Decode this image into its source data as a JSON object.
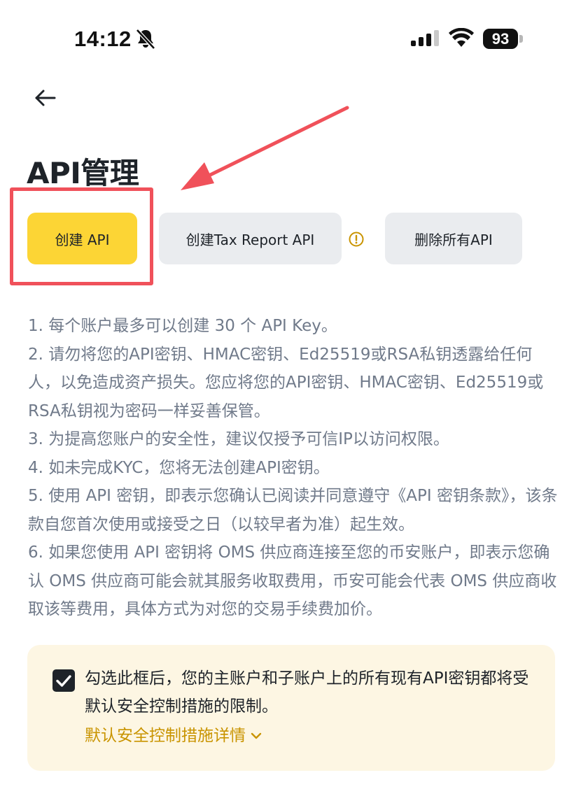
{
  "status_bar": {
    "time": "14:12",
    "battery": "93",
    "icons": [
      "bell-off-icon",
      "signal-icon",
      "wifi-icon",
      "battery-icon"
    ]
  },
  "header": {
    "back_icon": "arrow-left-icon"
  },
  "page_title": "API管理",
  "buttons": {
    "create_api": "创建 API",
    "create_tax_report_api": "创建Tax Report API",
    "delete_all_api": "删除所有API"
  },
  "notes": [
    "1. 每个账户最多可以创建 30 个 API Key。",
    "2. 请勿将您的API密钥、HMAC密钥、Ed25519或RSA私钥透露给任何人，以免造成资产损失。您应将您的API密钥、HMAC密钥、Ed25519或RSA私钥视为密码一样妥善保管。",
    "3. 为提高您账户的安全性，建议仅授予可信IP以访问权限。",
    "4. 如未完成KYC，您将无法创建API密钥。",
    "5. 使用 API 密钥，即表示您确认已阅读并同意遵守《API 密钥条款》，该条款自您首次使用或接受之日（以较早者为准）起生效。",
    "6. 如果您使用 API 密钥将 OMS 供应商连接至您的币安账户，即表示您确认 OMS 供应商可能会就其服务收取费用，币安可能会代表 OMS 供应商收取该等费用，具体方式为对您的交易手续费加价。"
  ],
  "consent": {
    "checked": true,
    "text": "勾选此框后，您的主账户和子账户上的所有现有API密钥都将受默认安全控制措施的限制。",
    "link": "默认安全控制措施详情"
  },
  "colors": {
    "primary": "#fcd535",
    "secondary_button": "#eaecef",
    "link": "#c99400",
    "annotation": "#f0515a",
    "panel": "#fdf6e3"
  }
}
